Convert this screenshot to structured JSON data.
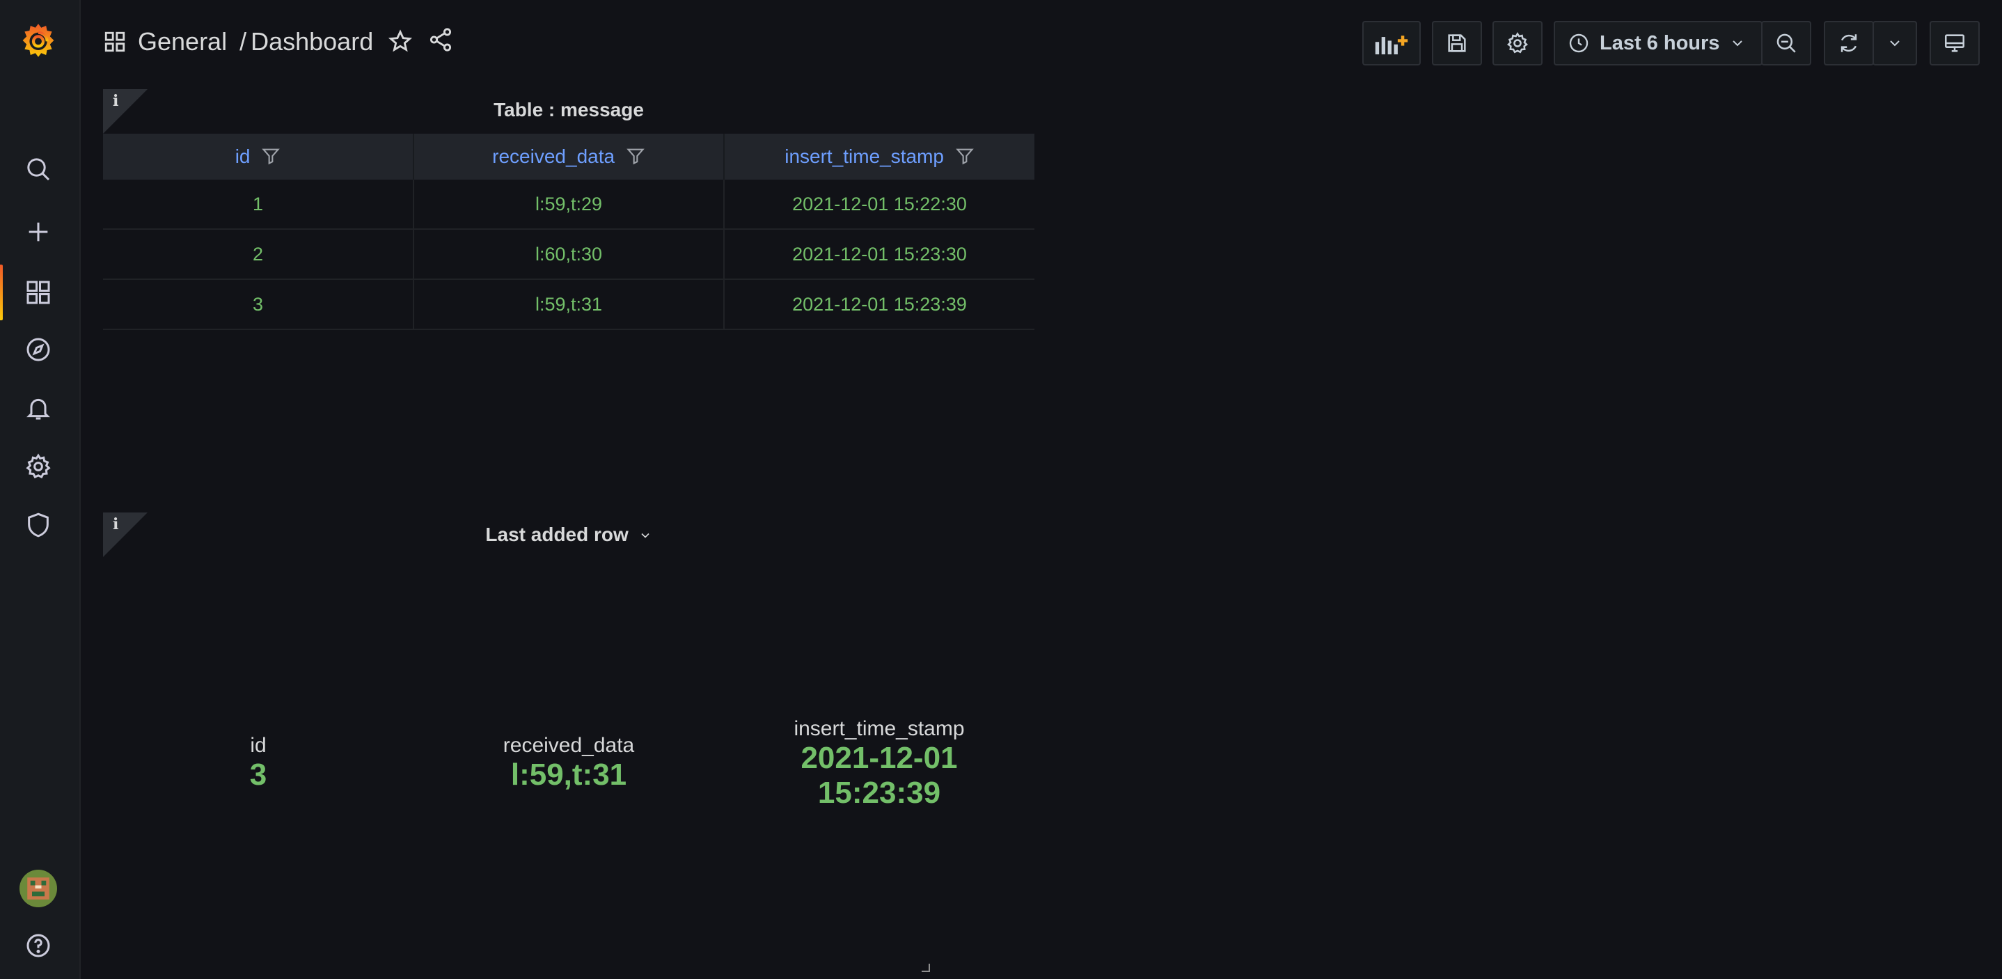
{
  "breadcrumb": {
    "folder": "General",
    "separator": "/",
    "dashboard": "Dashboard"
  },
  "toolbar": {
    "time_range": "Last 6 hours"
  },
  "sidebar": {
    "items": [
      "search-icon",
      "plus-icon",
      "dashboards-icon",
      "explore-icon",
      "alerting-icon",
      "configuration-icon",
      "shield-icon"
    ],
    "active": "dashboards-icon"
  },
  "table_panel": {
    "title": "Table : message",
    "columns": [
      "id",
      "received_data",
      "insert_time_stamp"
    ],
    "rows": [
      [
        "1",
        "l:59,t:29",
        "2021-12-01 15:22:30"
      ],
      [
        "2",
        "l:60,t:30",
        "2021-12-01 15:23:30"
      ],
      [
        "3",
        "l:59,t:31",
        "2021-12-01 15:23:39"
      ]
    ]
  },
  "stat_panel": {
    "title": "Last added row",
    "stats": [
      {
        "label": "id",
        "value": "3"
      },
      {
        "label": "received_data",
        "value": "l:59,t:31"
      },
      {
        "label": "insert_time_stamp",
        "value_line1": "2021-12-01",
        "value_line2": "15:23:39"
      }
    ]
  },
  "colors": {
    "accent": "#f05a28",
    "value_green": "#73bf69",
    "header_blue": "#6e9fff",
    "background": "#111217"
  }
}
